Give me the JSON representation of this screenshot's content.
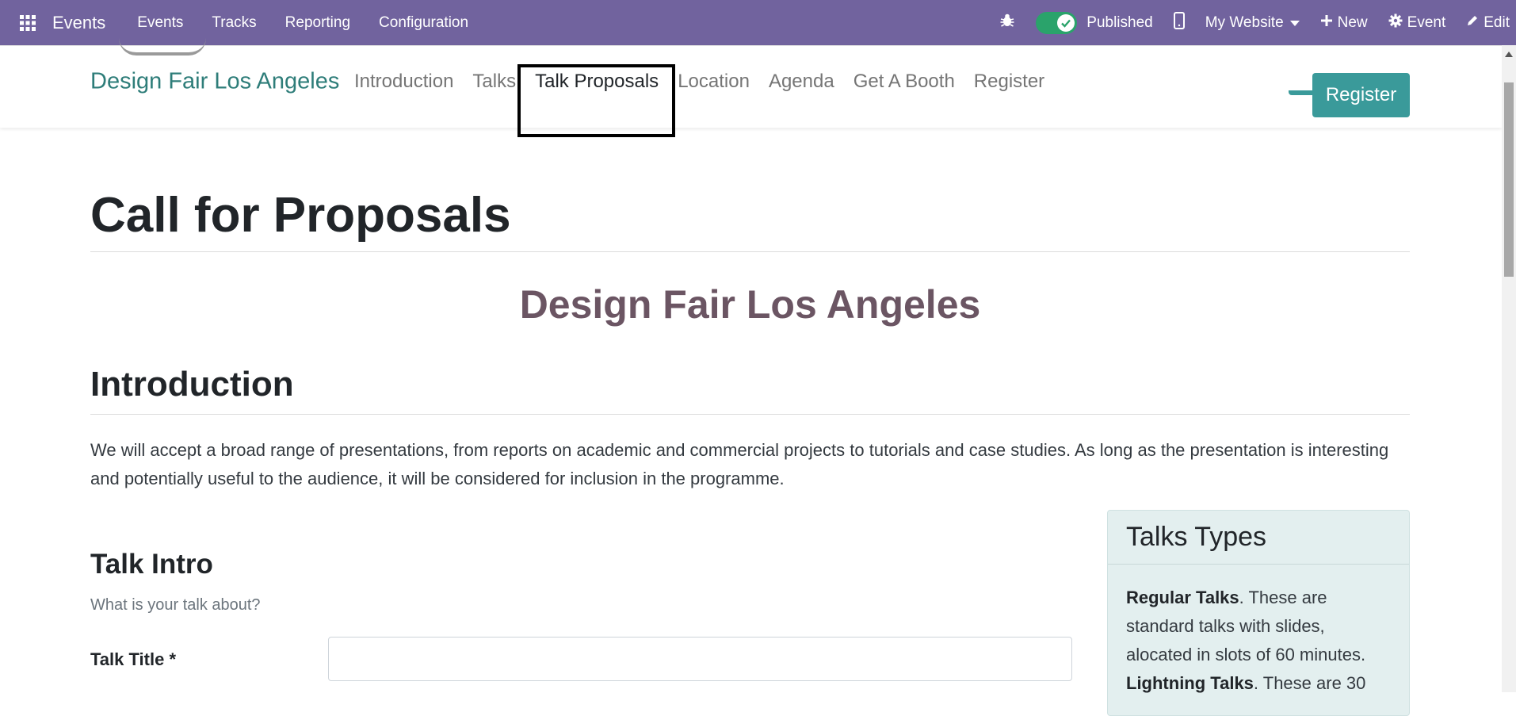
{
  "topbar": {
    "app_name": "Events",
    "menu": [
      "Events",
      "Tracks",
      "Reporting",
      "Configuration"
    ],
    "published_label": "Published",
    "website_label": "My Website",
    "new_label": "New",
    "event_label": "Event",
    "edit_label": "Edit",
    "colors": {
      "bar": "#71639e",
      "toggle_on": "#2aa36b"
    }
  },
  "event_nav": {
    "title": "Design Fair Los Angeles",
    "links": [
      "Introduction",
      "Talks",
      "Talk Proposals",
      "Location",
      "Agenda",
      "Get A Booth",
      "Register"
    ],
    "active_link": "Talk Proposals",
    "register_button": "Register"
  },
  "content": {
    "page_title": "Call for Proposals",
    "event_title": "Design Fair Los Angeles",
    "intro_heading": "Introduction",
    "intro_text": "We will accept a broad range of presentations, from reports on academic and commercial projects to tutorials and case studies. As long as the presentation is interesting and potentially useful to the audience, it will be considered for inclusion in the programme.",
    "talk_intro_heading": "Talk Intro",
    "talk_intro_sub": "What is your talk about?",
    "talk_title_label": "Talk Title *",
    "talk_title_value": ""
  },
  "sidebar": {
    "heading": "Talks Types",
    "regular_bold": "Regular Talks",
    "regular_text": ". These are standard talks with slides, alocated in slots of 60 minutes.",
    "lightning_bold": "Lightning Talks",
    "lightning_text": ". These are 30"
  }
}
